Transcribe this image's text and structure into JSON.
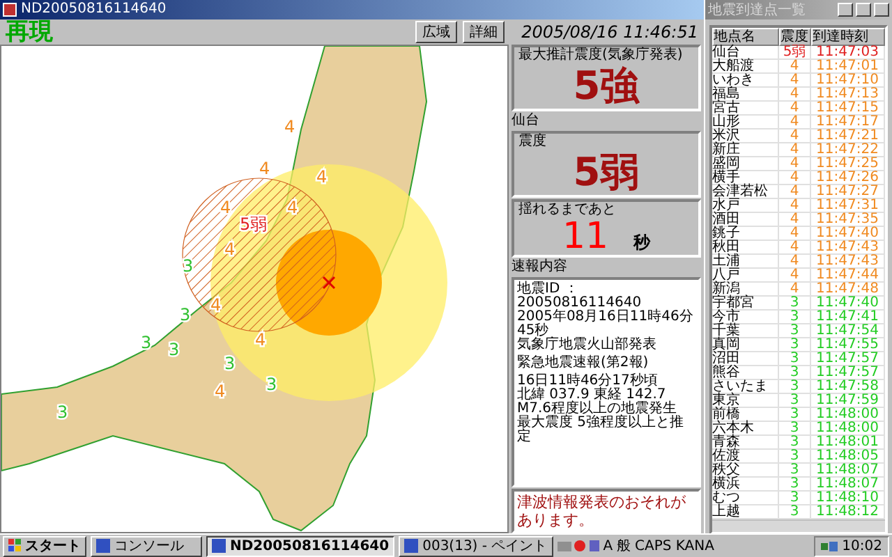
{
  "window": {
    "title": "ND20050816114640"
  },
  "header": {
    "mode": "再現",
    "buttons": [
      "広域",
      "詳細"
    ],
    "datetime": "2005/08/16 11:46:51"
  },
  "map": {
    "labels": [
      {
        "text": "4",
        "color": "#f08a20"
      },
      {
        "text": "4",
        "color": "#f08a20"
      },
      {
        "text": "4",
        "color": "#f08a20"
      },
      {
        "text": "4",
        "color": "#f08a20"
      },
      {
        "text": "4",
        "color": "#f08a20"
      },
      {
        "text": "4",
        "color": "#f08a20"
      },
      {
        "text": "4",
        "color": "#f08a20"
      },
      {
        "text": "4",
        "color": "#f08a20"
      },
      {
        "text": "4",
        "color": "#f08a20"
      },
      {
        "text": "5弱",
        "color": "#e02020"
      },
      {
        "text": "3",
        "color": "#30c030"
      },
      {
        "text": "3",
        "color": "#30c030"
      },
      {
        "text": "3",
        "color": "#30c030"
      },
      {
        "text": "3",
        "color": "#30c030"
      },
      {
        "text": "3",
        "color": "#30c030"
      },
      {
        "text": "3",
        "color": "#30c030"
      },
      {
        "text": "3",
        "color": "#30c030"
      }
    ]
  },
  "summary": {
    "max_label": "最大推計震度",
    "max_note": "(気象庁発表)",
    "max_value": "5強",
    "place": "仙台",
    "local_label": "震度",
    "local_value": "5弱",
    "countdown_label": "揺れるまであと",
    "countdown_value": "11",
    "countdown_unit": "秒"
  },
  "bulletin": {
    "title": "速報内容",
    "paragraphs": [
      [
        "地震ID ：20050816114640",
        "2005年08月16日11時46分45秒",
        "気象庁地震火山部発表"
      ],
      [
        "緊急地震速報(第2報)"
      ],
      [
        "16日11時46分17秒頃",
        "北緯 037.9 東経 142.7",
        "M7.6程度以上の地震発生",
        "最大震度 5強程度以上と推定"
      ]
    ],
    "tsunami": "津波情報発表のおそれがあります。"
  },
  "stations": {
    "title": "地震到達点一覧",
    "columns": [
      "地点名",
      "震度",
      "到達時刻"
    ],
    "rows": [
      {
        "name": "仙台",
        "intensity": "5弱",
        "time": "11:47:03",
        "color": "#e02020"
      },
      {
        "name": "大船渡",
        "intensity": "4",
        "time": "11:47:01",
        "color": "#f08a20"
      },
      {
        "name": "いわき",
        "intensity": "4",
        "time": "11:47:10",
        "color": "#f08a20"
      },
      {
        "name": "福島",
        "intensity": "4",
        "time": "11:47:13",
        "color": "#f08a20"
      },
      {
        "name": "宮古",
        "intensity": "4",
        "time": "11:47:15",
        "color": "#f08a20"
      },
      {
        "name": "山形",
        "intensity": "4",
        "time": "11:47:17",
        "color": "#f08a20"
      },
      {
        "name": "米沢",
        "intensity": "4",
        "time": "11:47:21",
        "color": "#f08a20"
      },
      {
        "name": "新庄",
        "intensity": "4",
        "time": "11:47:22",
        "color": "#f08a20"
      },
      {
        "name": "盛岡",
        "intensity": "4",
        "time": "11:47:25",
        "color": "#f08a20"
      },
      {
        "name": "横手",
        "intensity": "4",
        "time": "11:47:26",
        "color": "#f08a20"
      },
      {
        "name": "会津若松",
        "intensity": "4",
        "time": "11:47:27",
        "color": "#f08a20"
      },
      {
        "name": "水戸",
        "intensity": "4",
        "time": "11:47:31",
        "color": "#f08a20"
      },
      {
        "name": "酒田",
        "intensity": "4",
        "time": "11:47:35",
        "color": "#f08a20"
      },
      {
        "name": "銚子",
        "intensity": "4",
        "time": "11:47:40",
        "color": "#f08a20"
      },
      {
        "name": "秋田",
        "intensity": "4",
        "time": "11:47:43",
        "color": "#f08a20"
      },
      {
        "name": "土浦",
        "intensity": "4",
        "time": "11:47:43",
        "color": "#f08a20"
      },
      {
        "name": "八戸",
        "intensity": "4",
        "time": "11:47:44",
        "color": "#f08a20"
      },
      {
        "name": "新潟",
        "intensity": "4",
        "time": "11:47:48",
        "color": "#f08a20"
      },
      {
        "name": "宇都宮",
        "intensity": "3",
        "time": "11:47:40",
        "color": "#22cc22"
      },
      {
        "name": "今市",
        "intensity": "3",
        "time": "11:47:41",
        "color": "#22cc22"
      },
      {
        "name": "千葉",
        "intensity": "3",
        "time": "11:47:54",
        "color": "#22cc22"
      },
      {
        "name": "真岡",
        "intensity": "3",
        "time": "11:47:55",
        "color": "#22cc22"
      },
      {
        "name": "沼田",
        "intensity": "3",
        "time": "11:47:57",
        "color": "#22cc22"
      },
      {
        "name": "熊谷",
        "intensity": "3",
        "time": "11:47:57",
        "color": "#22cc22"
      },
      {
        "name": "さいたま",
        "intensity": "3",
        "time": "11:47:58",
        "color": "#22cc22"
      },
      {
        "name": "東京",
        "intensity": "3",
        "time": "11:47:59",
        "color": "#22cc22"
      },
      {
        "name": "前橋",
        "intensity": "3",
        "time": "11:48:00",
        "color": "#22cc22"
      },
      {
        "name": "六本木",
        "intensity": "3",
        "time": "11:48:00",
        "color": "#22cc22"
      },
      {
        "name": "青森",
        "intensity": "3",
        "time": "11:48:01",
        "color": "#22cc22"
      },
      {
        "name": "佐渡",
        "intensity": "3",
        "time": "11:48:05",
        "color": "#22cc22"
      },
      {
        "name": "秩父",
        "intensity": "3",
        "time": "11:48:07",
        "color": "#22cc22"
      },
      {
        "name": "横浜",
        "intensity": "3",
        "time": "11:48:07",
        "color": "#22cc22"
      },
      {
        "name": "むつ",
        "intensity": "3",
        "time": "11:48:10",
        "color": "#22cc22"
      },
      {
        "name": "上越",
        "intensity": "3",
        "time": "11:48:12",
        "color": "#22cc22"
      }
    ]
  },
  "taskbar": {
    "start": "スタート",
    "tasks": [
      {
        "label": "コンソール",
        "selected": false
      },
      {
        "label": "ND20050816114640",
        "selected": true
      },
      {
        "label": "003(13) - ペイント",
        "selected": false
      }
    ],
    "ime": [
      "A",
      "般"
    ],
    "keys": "CAPS KANA",
    "clock": "10:02"
  }
}
